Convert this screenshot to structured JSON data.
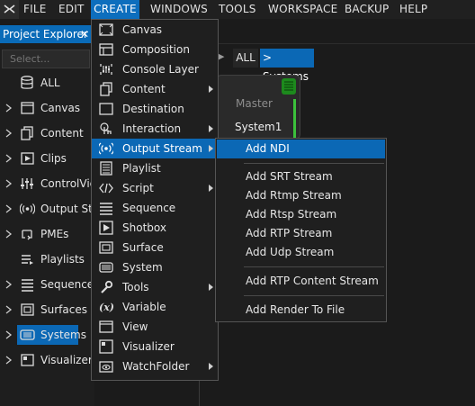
{
  "menubar": {
    "items": [
      {
        "label": "FILE"
      },
      {
        "label": "EDIT"
      },
      {
        "label": "CREATE"
      },
      {
        "label": "WINDOWS"
      },
      {
        "label": "TOOLS"
      },
      {
        "label": "WORKSPACE"
      },
      {
        "label": "BACKUP"
      },
      {
        "label": "HELP"
      }
    ]
  },
  "project_explorer": {
    "title": "Project Explorer",
    "close": "✕",
    "search_placeholder": "Select...",
    "items": [
      {
        "label": "ALL",
        "icon": "database-icon",
        "expandable": false
      },
      {
        "label": "Canvas",
        "icon": "canvas-icon",
        "expandable": true
      },
      {
        "label": "Content",
        "icon": "content-icon",
        "expandable": true
      },
      {
        "label": "Clips",
        "icon": "clips-icon",
        "expandable": true
      },
      {
        "label": "ControlView",
        "icon": "controlview-icon",
        "expandable": true
      },
      {
        "label": "Output Stream",
        "icon": "output-stream-icon",
        "expandable": true
      },
      {
        "label": "PMEs",
        "icon": "pmes-icon",
        "expandable": true
      },
      {
        "label": "Playlists",
        "icon": "playlists-icon",
        "expandable": false
      },
      {
        "label": "Sequences",
        "icon": "sequences-icon",
        "expandable": true
      },
      {
        "label": "Surfaces",
        "icon": "surfaces-icon",
        "expandable": true
      },
      {
        "label": "Systems",
        "icon": "systems-icon",
        "expandable": true,
        "selected": true
      },
      {
        "label": "Visualizers",
        "icon": "visualizers-icon",
        "expandable": true
      }
    ]
  },
  "breadcrumb": {
    "all": "ALL",
    "current": "> Systems"
  },
  "node": {
    "master": "Master",
    "name": "System1"
  },
  "create_menu": {
    "items": [
      {
        "label": "Canvas",
        "icon": "canvas-icon",
        "submenu": false
      },
      {
        "label": "Composition",
        "icon": "composition-icon",
        "submenu": false
      },
      {
        "label": "Console Layer",
        "icon": "console-layer-icon",
        "submenu": false
      },
      {
        "label": "Content",
        "icon": "content-icon",
        "submenu": true
      },
      {
        "label": "Destination",
        "icon": "destination-icon",
        "submenu": false
      },
      {
        "label": "Interaction",
        "icon": "interaction-icon",
        "submenu": true
      },
      {
        "label": "Output Stream",
        "icon": "output-stream-icon",
        "submenu": true,
        "highlighted": true
      },
      {
        "label": "Playlist",
        "icon": "playlist-icon",
        "submenu": false
      },
      {
        "label": "Script",
        "icon": "script-icon",
        "submenu": true
      },
      {
        "label": "Sequence",
        "icon": "sequence-icon",
        "submenu": false
      },
      {
        "label": "Shotbox",
        "icon": "shotbox-icon",
        "submenu": false
      },
      {
        "label": "Surface",
        "icon": "surface-icon",
        "submenu": false
      },
      {
        "label": "System",
        "icon": "system-icon",
        "submenu": false
      },
      {
        "label": "Tools",
        "icon": "tools-icon",
        "submenu": true
      },
      {
        "label": "Variable",
        "icon": "variable-icon",
        "submenu": false
      },
      {
        "label": "View",
        "icon": "view-icon",
        "submenu": false
      },
      {
        "label": "Visualizer",
        "icon": "visualizer-icon",
        "submenu": false
      },
      {
        "label": "WatchFolder",
        "icon": "watchfolder-icon",
        "submenu": true
      }
    ]
  },
  "output_stream_submenu": {
    "items": [
      {
        "label": "Add NDI",
        "highlighted": true
      },
      {
        "label": "Add SRT Stream"
      },
      {
        "label": "Add Rtmp Stream"
      },
      {
        "label": "Add Rtsp Stream"
      },
      {
        "label": "Add RTP Stream"
      },
      {
        "label": "Add Udp Stream"
      },
      {
        "label": "Add RTP Content Stream"
      },
      {
        "label": "Add Render To File"
      }
    ]
  },
  "colors": {
    "accent": "#0b68b5",
    "menu_background": "#1f1f1f",
    "status_green": "#3cc13c"
  }
}
